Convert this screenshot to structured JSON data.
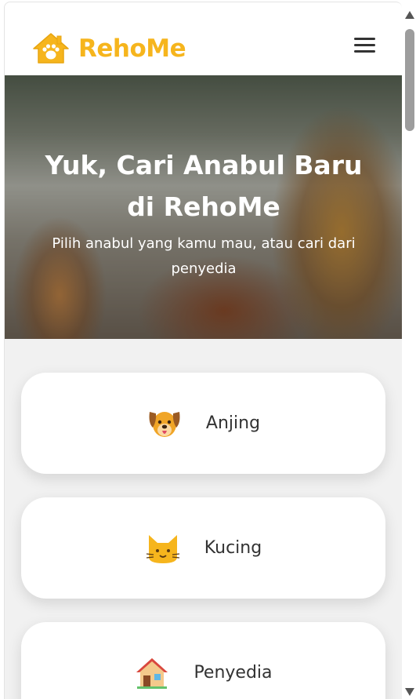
{
  "navbar": {
    "brand": "RehoMe",
    "logo_icon": "paw-house-icon",
    "menu_icon": "hamburger-menu-icon"
  },
  "hero": {
    "title": "Yuk, Cari Anabul Baru di RehoMe",
    "subtitle": "Pilih anabul yang kamu mau, atau cari dari penyedia"
  },
  "categories": [
    {
      "label": "Anjing",
      "icon": "dog-face-icon"
    },
    {
      "label": "Kucing",
      "icon": "cat-face-icon"
    },
    {
      "label": "Penyedia",
      "icon": "house-icon"
    }
  ],
  "colors": {
    "brand": "#f6b51d",
    "page_background": "#f1f1f1",
    "card_background": "#ffffff"
  }
}
